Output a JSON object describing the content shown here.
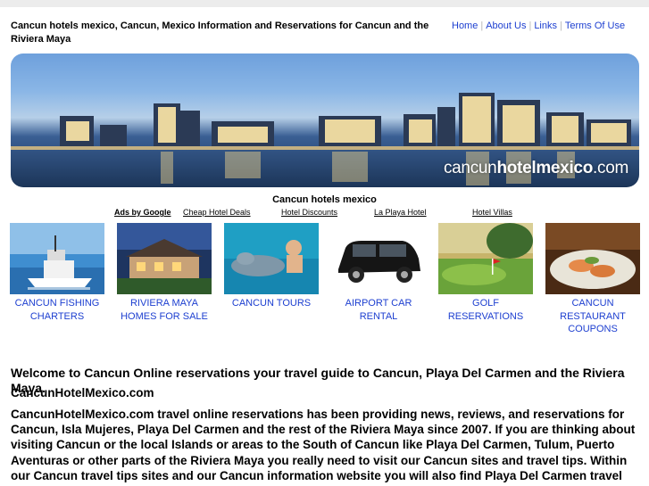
{
  "header": {
    "title": "Cancun hotels mexico, Cancun, Mexico Information and Reservations for Cancun and the Riviera Maya",
    "nav": [
      "Home",
      "About Us",
      "Links",
      "Terms Of Use"
    ]
  },
  "banner": {
    "logo_light": "cancun",
    "logo_bold": "hotelmexico",
    "logo_suffix": ".com"
  },
  "caption": "Cancun hotels mexico",
  "ads": {
    "label": "Ads by Google",
    "links": [
      "Cheap Hotel Deals",
      "Hotel Discounts",
      "La Playa Hotel",
      "Hotel Villas"
    ]
  },
  "tiles": [
    {
      "label": "CANCUN FISHING CHARTERS",
      "image": "fishing-boat-photo"
    },
    {
      "label": "RIVIERA MAYA HOMES FOR SALE",
      "image": "house-photo"
    },
    {
      "label": "CANCUN TOURS",
      "image": "dolphin-swim-photo"
    },
    {
      "label": "AIRPORT CAR RENTAL",
      "image": "black-minivan-photo"
    },
    {
      "label": "GOLF RESERVATIONS",
      "image": "golf-course-photo"
    },
    {
      "label": "CANCUN RESTAURANT COUPONS",
      "image": "seafood-dish-photo"
    }
  ],
  "content": {
    "welcome": "Welcome to Cancun Online reservations your travel guide to Cancun, Playa Del Carmen and the Riviera Maya.",
    "site_name": "CancunHotelMexico.com",
    "body": "CancunHotelMexico.com travel online reservations has been providing news, reviews, and reservations for Cancun, Isla Mujeres, Playa Del Carmen and the rest of the Riviera Maya since 2007. If you are thinking about visiting Cancun or the local Islands or areas to the South of Cancun like Playa Del Carmen, Tulum, Puerto Aventuras or other parts of the Riviera Maya you really need to visit our Cancun sites and travel tips. Within our Cancun travel tips sites and our Cancun information website you will also find Playa Del Carmen travel"
  },
  "colors": {
    "link": "#1d3fd0",
    "separator": "#b8b8b8"
  }
}
